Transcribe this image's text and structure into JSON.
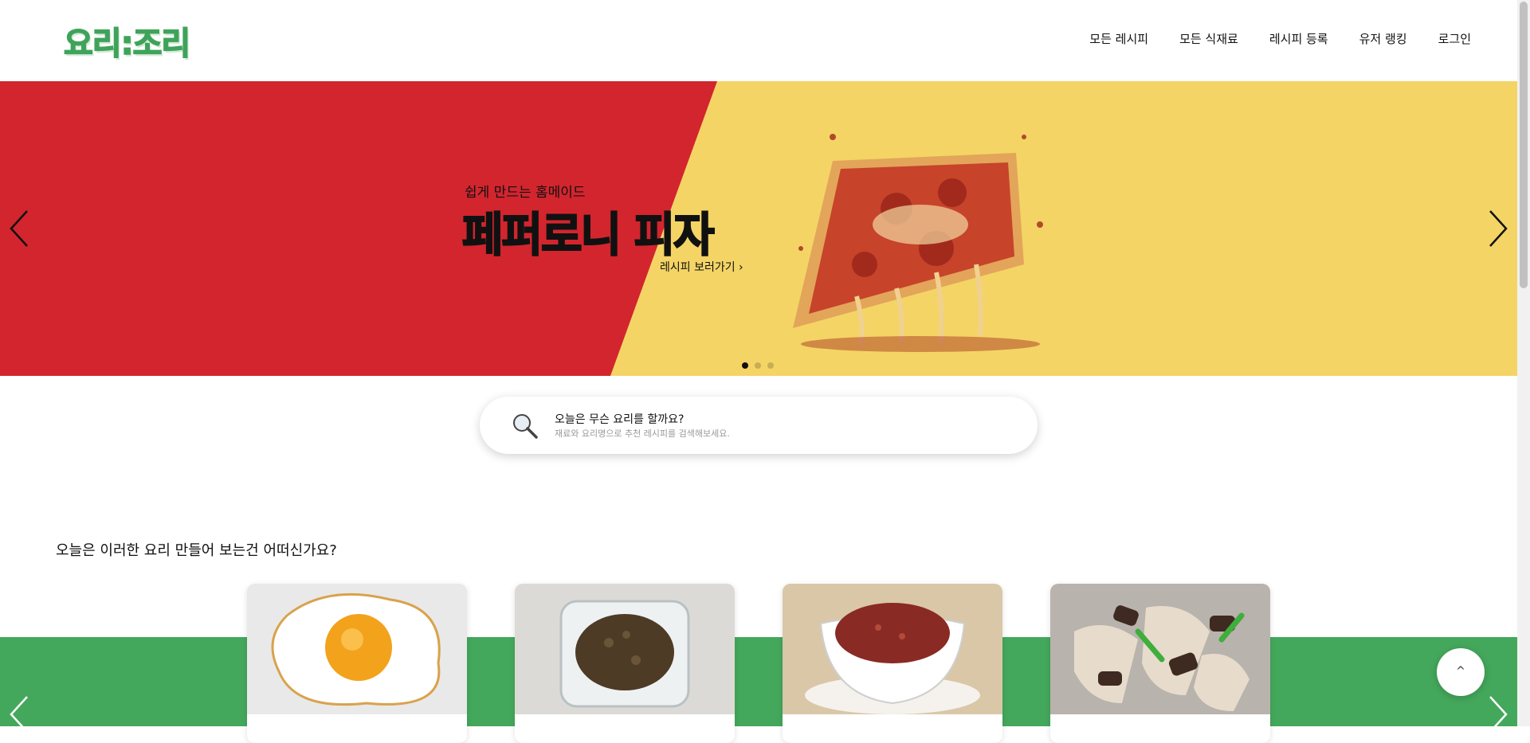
{
  "header": {
    "logo": "요리:조리",
    "nav": [
      "모든 레시피",
      "모든 식재료",
      "레시피 등록",
      "유저 랭킹",
      "로그인"
    ]
  },
  "hero": {
    "subtitle": "쉽게 만드는 홈메이드",
    "title": "페퍼로니 피자",
    "link": "레시피 보러가기 ›",
    "slide_count": 3,
    "active_slide": 1,
    "colors": {
      "left": "#d2252e",
      "right": "#f4d465"
    }
  },
  "search": {
    "question": "오늘은 무슨 요리를 할까요?",
    "hint": "재료와 요리명으로 추천 레시피를 검색해보세요."
  },
  "recommend": {
    "title": "오늘은 이러한 요리 만들어 보는건 어떠신가요?",
    "cards": [
      {
        "icon": "fried-egg-image"
      },
      {
        "icon": "bulgogi-image"
      },
      {
        "icon": "red-pepper-paste-image"
      },
      {
        "icon": "stir-fried-mushroom-image"
      }
    ],
    "band_color": "#44a85c"
  },
  "top_button": "^"
}
